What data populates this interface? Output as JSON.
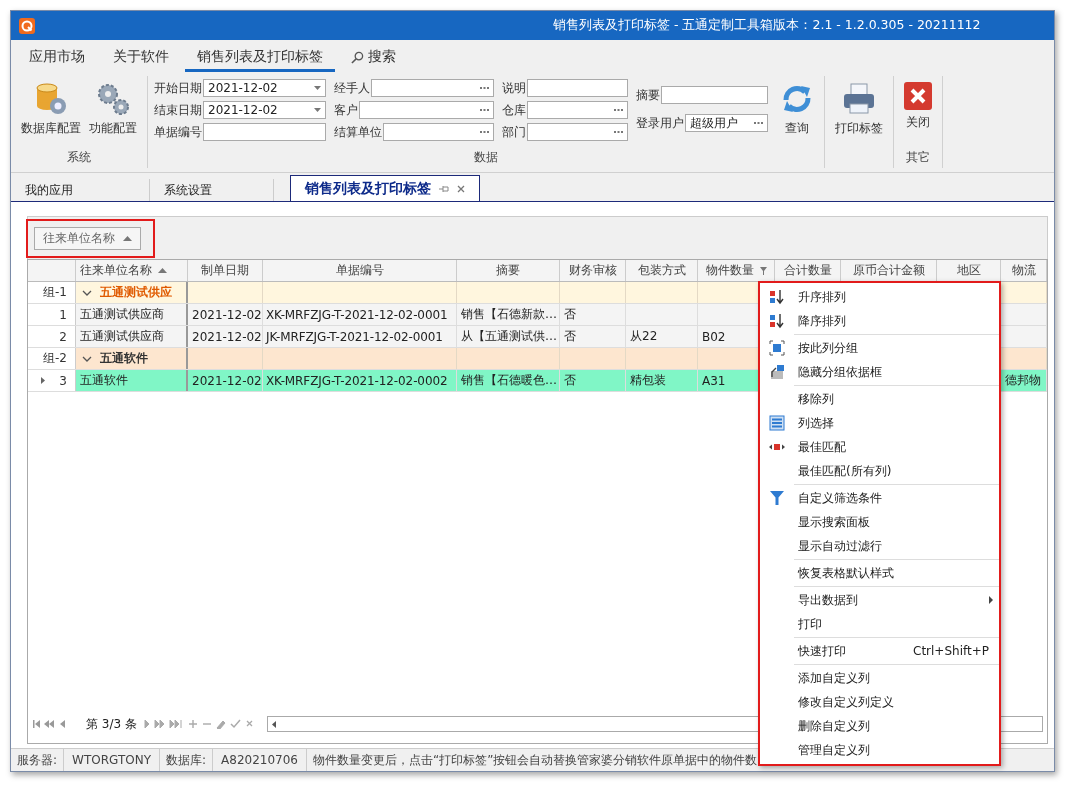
{
  "window": {
    "title": "销售列表及打印标签 - 五通定制工具箱版本：2.1 - 1.2.0.305 - 20211112"
  },
  "ribbon_tabs": [
    {
      "label": "应用市场",
      "selected": false,
      "kind": "plain"
    },
    {
      "label": "关于软件",
      "selected": false,
      "kind": "plain"
    },
    {
      "label": "销售列表及打印标签",
      "selected": true,
      "kind": "plain"
    },
    {
      "label": "搜索",
      "selected": false,
      "kind": "search"
    }
  ],
  "ribbon_groups": [
    {
      "caption": "系统",
      "kind": "buttons",
      "buttons": [
        {
          "label": "数据库配置",
          "kind": "database"
        },
        {
          "label": "功能配置",
          "kind": "gears"
        }
      ]
    },
    {
      "caption": "数据",
      "kind": "filters",
      "field_columns": [
        [
          {
            "label": "开始日期",
            "value": "2021-12-02",
            "kind": "date"
          },
          {
            "label": "结束日期",
            "value": "2021-12-02",
            "kind": "date"
          },
          {
            "label": "单据编号",
            "kind": "text"
          }
        ],
        [
          {
            "label": "经手人",
            "kind": "lookup"
          },
          {
            "label": "客户",
            "kind": "lookup"
          },
          {
            "label": "结算单位",
            "kind": "lookup"
          }
        ],
        [
          {
            "label": "说明",
            "kind": "text"
          },
          {
            "label": "仓库",
            "kind": "lookup"
          },
          {
            "label": "部门",
            "kind": "lookup"
          }
        ],
        [
          {
            "label": "摘要",
            "kind": "text"
          },
          {
            "label": "登录用户",
            "value": "超级用户",
            "kind": "lookup"
          }
        ]
      ],
      "buttons": [
        {
          "label": "查询",
          "kind": "refresh"
        }
      ]
    },
    {
      "kind": "buttons",
      "buttons": [
        {
          "label": "打印标签",
          "kind": "printer"
        }
      ]
    },
    {
      "caption": "其它",
      "kind": "buttons",
      "buttons": [
        {
          "label": "关闭",
          "kind": "close"
        }
      ]
    }
  ],
  "doc_tabs": [
    {
      "label": "我的应用",
      "selected": false,
      "closable": false
    },
    {
      "label": "系统设置",
      "selected": false,
      "closable": false
    },
    {
      "label": "销售列表及打印标签",
      "selected": true,
      "closable": true
    }
  ],
  "grid": {
    "group_panel": {
      "chips": [
        {
          "label": "往来单位名称",
          "sorted": true
        }
      ]
    },
    "columns": [
      {
        "label": "往来单位名称",
        "sorted": true
      },
      {
        "label": "制单日期"
      },
      {
        "label": "单据编号"
      },
      {
        "label": "摘要"
      },
      {
        "label": "财务审核"
      },
      {
        "label": "包装方式"
      },
      {
        "label": "物件数量",
        "filter": true
      },
      {
        "label": "合计数量"
      },
      {
        "label": "原币合计金额"
      },
      {
        "label": "地区"
      },
      {
        "label": "物流"
      }
    ],
    "rows": [
      {
        "kind": "group",
        "indicator": "组-1",
        "label": "五通测试供应",
        "highlighted": true
      },
      {
        "kind": "data",
        "indicator": "1",
        "selected": false,
        "cells": [
          "五通测试供应商",
          "2021-12-02",
          "XK-MRFZJG-T-2021-12-02-0001",
          "销售【石德新款…",
          "否"
        ]
      },
      {
        "kind": "data",
        "indicator": "2",
        "selected": false,
        "cells": [
          "五通测试供应商",
          "2021-12-02",
          "JK-MRFZJG-T-2021-12-02-0001",
          "从【五通测试供…",
          "否",
          "从22",
          "B02"
        ]
      },
      {
        "kind": "group",
        "indicator": "组-2",
        "label": "五通软件",
        "highlighted": false
      },
      {
        "kind": "data",
        "indicator": "3",
        "selected": true,
        "cells": [
          "五通软件",
          "2021-12-02",
          "XK-MRFZJG-T-2021-12-02-0002",
          "销售【石德暖色…",
          "否",
          "精包装",
          "A31"
        ],
        "logistics": "德邦物"
      }
    ]
  },
  "navigator": {
    "position": "第 3/3 条"
  },
  "status_bar": [
    {
      "text": "服务器:",
      "kind": "label"
    },
    {
      "text": "WTORGTONY",
      "kind": "value"
    },
    {
      "text": "数据库:",
      "kind": "label"
    },
    {
      "text": "A820210706",
      "kind": "value"
    },
    {
      "text": "物件数量变更后，点击“打印标签”按钮会自动替换管家婆分销软件原单据中的物件数",
      "kind": "message"
    }
  ],
  "context_menu": {
    "items": [
      {
        "label": "升序排列",
        "kind": "sort-asc",
        "separator_before": false,
        "submenu": false
      },
      {
        "label": "降序排列",
        "kind": "sort-desc",
        "separator_before": false,
        "submenu": false
      },
      {
        "label": "按此列分组",
        "kind": "group",
        "separator_before": true,
        "submenu": false
      },
      {
        "label": "隐藏分组依据框",
        "kind": "hide-group",
        "separator_before": false,
        "submenu": false
      },
      {
        "label": "移除列",
        "separator_before": true,
        "submenu": false
      },
      {
        "label": "列选择",
        "kind": "columns",
        "separator_before": false,
        "submenu": false
      },
      {
        "label": "最佳匹配",
        "kind": "best-fit",
        "separator_before": false,
        "submenu": false
      },
      {
        "label": "最佳匹配(所有列)",
        "separator_before": false,
        "submenu": false
      },
      {
        "label": "自定义筛选条件",
        "kind": "filter",
        "separator_before": true,
        "submenu": false
      },
      {
        "label": "显示搜索面板",
        "separator_before": false,
        "submenu": false
      },
      {
        "label": "显示自动过滤行",
        "separator_before": false,
        "submenu": false
      },
      {
        "label": "恢复表格默认样式",
        "separator_before": true,
        "submenu": false
      },
      {
        "label": "导出数据到",
        "separator_before": true,
        "submenu": true
      },
      {
        "label": "打印",
        "separator_before": false,
        "submenu": false
      },
      {
        "label": "快速打印",
        "shortcut": "Ctrl+Shift+P",
        "separator_before": true,
        "submenu": false
      },
      {
        "label": "添加自定义列",
        "separator_before": true,
        "submenu": false
      },
      {
        "label": "修改自定义列定义",
        "separator_before": false,
        "submenu": false
      },
      {
        "label": "删除自定义列",
        "separator_before": false,
        "submenu": false
      },
      {
        "label": "管理自定义列",
        "separator_before": false,
        "submenu": false
      }
    ]
  }
}
